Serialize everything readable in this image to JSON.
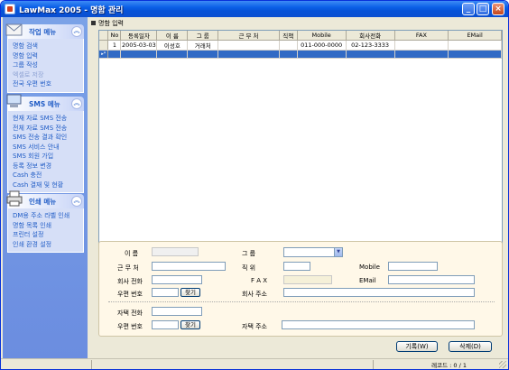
{
  "window": {
    "title": "LawMax 2005 - 명함 관리"
  },
  "sidebar": {
    "panels": [
      {
        "title": "작업 메뉴",
        "items": [
          {
            "label": "명함 검색",
            "dim": false
          },
          {
            "label": "명함 입력",
            "dim": false
          },
          {
            "label": "그룹 작성",
            "dim": false
          },
          {
            "label": "엑셀로 저장",
            "dim": true
          },
          {
            "label": "전국 우편 번호",
            "dim": false
          }
        ]
      },
      {
        "title": "SMS 메뉴",
        "items": [
          {
            "label": "현재 자료 SMS 전송",
            "dim": false
          },
          {
            "label": "전체 자료 SMS 전송",
            "dim": false
          },
          {
            "label": "SMS 전송 결과 확인",
            "dim": false
          },
          {
            "label": "SMS 서비스 안내",
            "dim": false
          },
          {
            "label": "SMS 회원 가입",
            "dim": false
          },
          {
            "label": "등록 정보 변경",
            "dim": false
          },
          {
            "label": "Cash 충전",
            "dim": false
          },
          {
            "label": "Cash 결재 및 현황",
            "dim": false
          }
        ]
      },
      {
        "title": "인쇄 메뉴",
        "items": [
          {
            "label": "DM용 주소 라벨 인쇄",
            "dim": false
          },
          {
            "label": "명함 목록 인쇄",
            "dim": false
          },
          {
            "label": "프린터 설정",
            "dim": false
          },
          {
            "label": "인쇄 환경 설정",
            "dim": false
          }
        ]
      }
    ]
  },
  "main": {
    "section_title": "명함 입력",
    "grid": {
      "columns": [
        "No",
        "등록일자",
        "이  름",
        "그  룹",
        "근  무  처",
        "직책",
        "Mobile",
        "회사전화",
        "FAX",
        "EMail"
      ],
      "rows": [
        [
          "1",
          "2005-03-03",
          "이성호",
          "거래처",
          "",
          "",
          "011-000-0000",
          "02-123-3333",
          "",
          ""
        ]
      ],
      "new_row_marker": "▸*"
    },
    "form": {
      "name_label": "이    름",
      "group_label": "그    룹",
      "group_value": "",
      "workplace_label": "근 무 처",
      "position_label": "직    위",
      "mobile_label": "Mobile",
      "office_phone_label": "회사 전화",
      "fax_label": "F A X",
      "email_label": "EMail",
      "office_zip_label": "우편 번호",
      "find_button": "찾기",
      "office_address_label": "회사 주소",
      "home_phone_label": "자택 전화",
      "home_zip_label": "우편 번호",
      "home_address_label": "자택 주소"
    },
    "buttons": {
      "save": "기록(W)",
      "delete": "삭제(D)"
    }
  },
  "status": {
    "record_text": "레코드 : 0 / 1"
  }
}
